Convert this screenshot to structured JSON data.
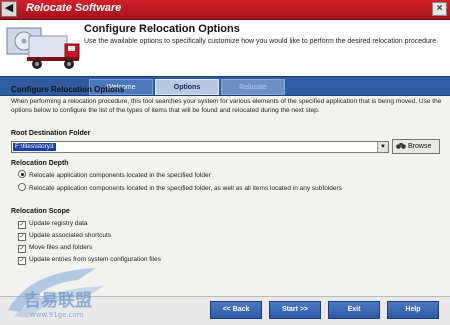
{
  "window": {
    "title": "Relocate Software",
    "system_menu_glyph": "◀",
    "close_glyph": "×"
  },
  "header": {
    "title": "Configure Relocation Options",
    "description": "Use the available options to specifically customize how you would like to perform the desired relocation procedure."
  },
  "tabs": [
    {
      "label": "Welcome",
      "state": "inactive"
    },
    {
      "label": "Options",
      "state": "active"
    },
    {
      "label": "Relocate",
      "state": "disabled"
    }
  ],
  "main": {
    "section_title": "Configure Relocation Options",
    "intro": "When performing a relocation procedure, this tool searches your system for various elements of the specified application that is being moved.  Use the options below to configure the list of the types of items that will be found and relocated during the next step.",
    "destination": {
      "label": "Root Destination Folder",
      "value": "F:\\files\\story3",
      "browse_label": "Browse",
      "dropdown_glyph": "▼"
    },
    "depth": {
      "label": "Relocation Depth",
      "options": [
        {
          "label": "Relocate application components located in the specified folder",
          "selected": true
        },
        {
          "label": "Relocate application components located in the specified folder, as well as all items located in any subfolders",
          "selected": false
        }
      ]
    },
    "scope": {
      "label": "Relocation Scope",
      "check_glyph": "✓",
      "items": [
        {
          "label": "Update registry data",
          "checked": true
        },
        {
          "label": "Update associated shortcuts",
          "checked": true
        },
        {
          "label": "Move files and folders",
          "checked": true
        },
        {
          "label": "Update entries from system configuration files",
          "checked": true
        }
      ]
    }
  },
  "footer": {
    "back": "<< Back",
    "start": "Start >>",
    "exit": "Exit",
    "help": "Help"
  },
  "watermark": {
    "brand": "吉易联盟",
    "url": "www.91ge.com"
  },
  "colors": {
    "titlebar": "#b8141c",
    "tabstrip": "#2f5ca0",
    "button": "#2b58a6"
  }
}
